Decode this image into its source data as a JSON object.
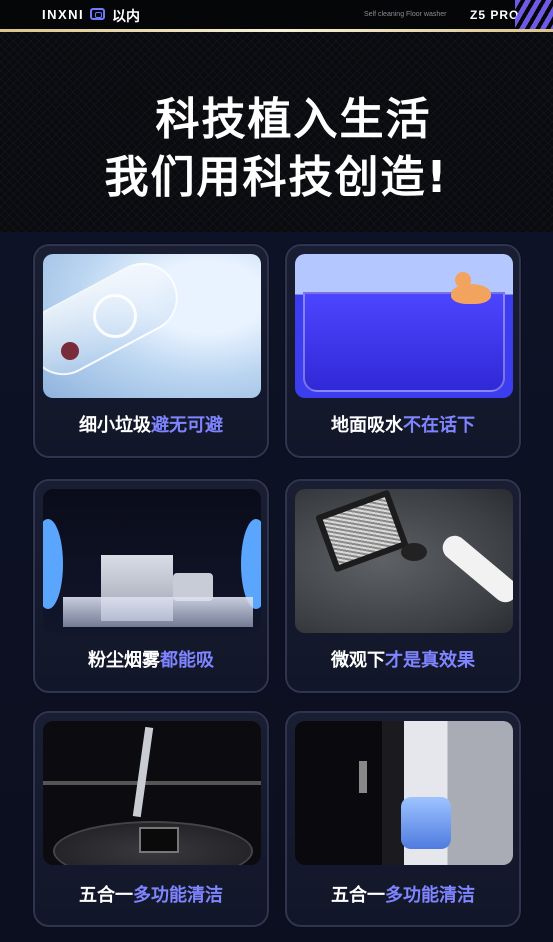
{
  "header": {
    "logo": "INXNI",
    "logo_icon": "brand-box-icon",
    "brand_cn": "以内",
    "tagline": "Self cleaning Floor washer",
    "model": "Z5 PRO"
  },
  "hero": {
    "line1": "科技植入生活",
    "line2": "我们用科技创造!"
  },
  "features": [
    {
      "caption_normal": "细小垃圾",
      "caption_highlight": "避无可避",
      "image": "tube-bubble-image"
    },
    {
      "caption_normal": "地面吸水",
      "caption_highlight": "不在话下",
      "image": "blue-water-image"
    },
    {
      "caption_normal": "粉尘烟雾",
      "caption_highlight": "都能吸",
      "image": "dust-smoke-image"
    },
    {
      "caption_normal": "微观下",
      "caption_highlight": "才是真效果",
      "image": "microscope-floor-image"
    },
    {
      "caption_normal": "五合一",
      "caption_highlight": "多功能清洁",
      "image": "mop-base-image"
    },
    {
      "caption_normal": "五合一",
      "caption_highlight": "多功能清洁",
      "image": "water-tank-image"
    }
  ],
  "colors": {
    "highlight": "#7f84ff",
    "accent_stripes": "#7a63ff"
  }
}
